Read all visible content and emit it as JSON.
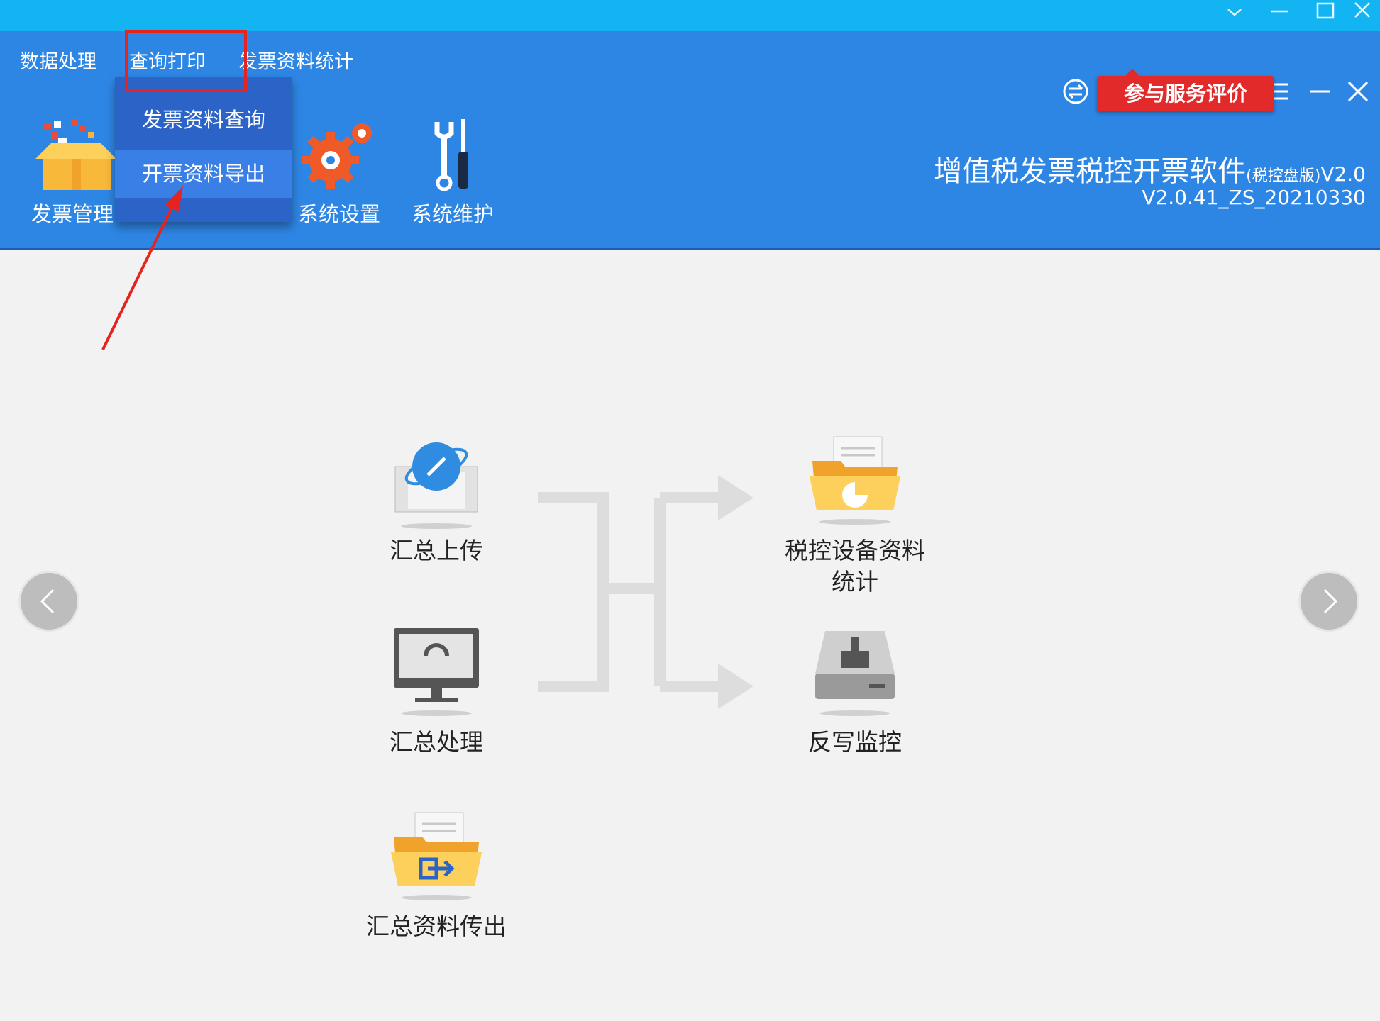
{
  "menu": {
    "items": [
      "数据处理",
      "查询打印",
      "发票资料统计"
    ],
    "dropdown": [
      "发票资料查询",
      "开票资料导出"
    ]
  },
  "toolbar": {
    "buttons": [
      "发票管理",
      "系统设置",
      "系统维护"
    ]
  },
  "header": {
    "icons": [
      "exchange-icon",
      "feedback-icon",
      "help-icon",
      "lock-icon",
      "user-icon",
      "menu-icon",
      "minimize-icon",
      "close-icon"
    ],
    "eval_badge": "参与服务评价",
    "app_title": "增值税发票税控开票软件",
    "app_title_suffix": "(税控盘版)",
    "app_title_version": "V2.0",
    "app_version": "V2.0.41_ZS_20210330"
  },
  "functions": {
    "upload": "汇总上传",
    "process": "汇总处理",
    "export": "汇总资料传出",
    "stats": "税控设备资料统计",
    "writeback": "反写监控"
  },
  "colors": {
    "titlebar": "#12b5f2",
    "header": "#2e86e4",
    "dropdown": "#2b63c7",
    "highlight": "#e52420",
    "badge": "#e22a2b"
  }
}
